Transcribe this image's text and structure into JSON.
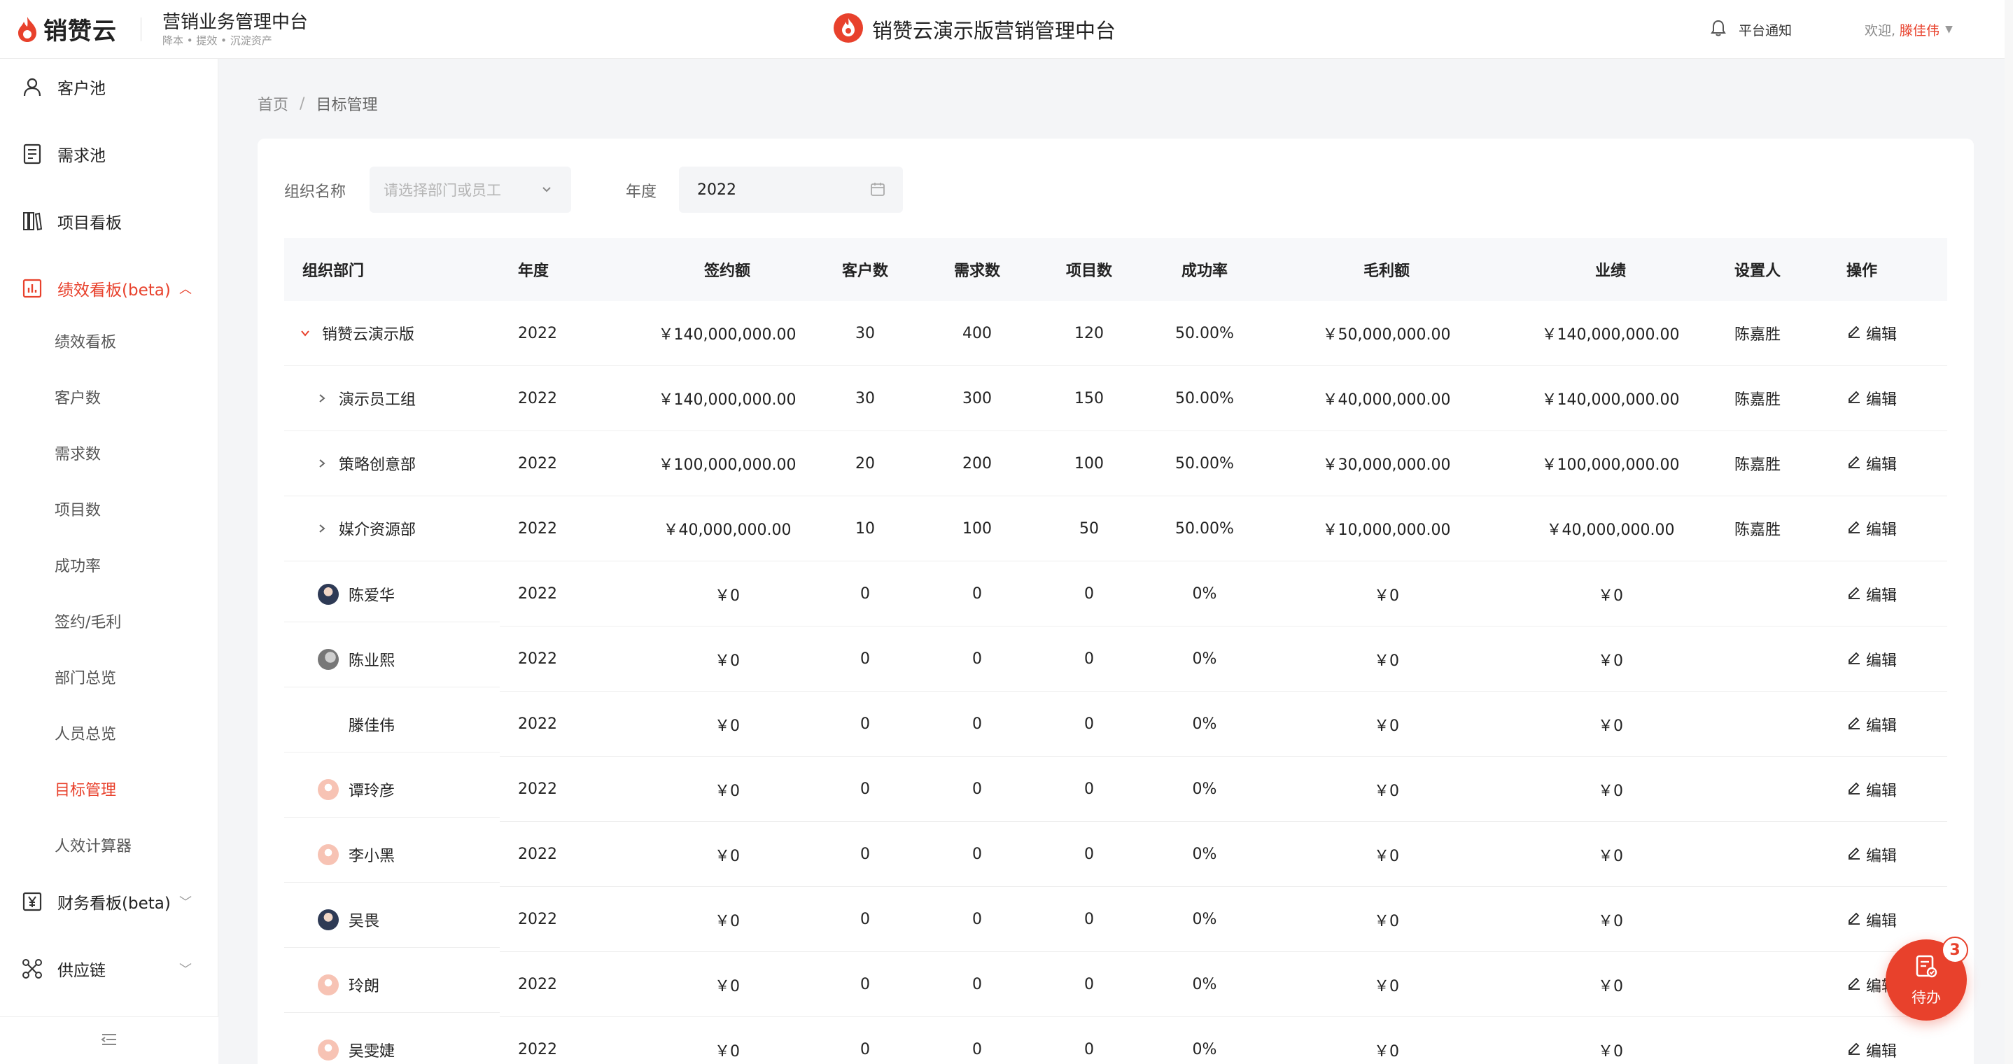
{
  "header": {
    "logo_text": "销赞云",
    "platform_title": "营销业务管理中台",
    "platform_sub": "降本 • 提效 • 沉淀资产",
    "center_title": "销赞云演示版营销管理中台",
    "notice_label": "平台通知",
    "welcome_label": "欢迎,",
    "username": "滕佳伟"
  },
  "sidebar": {
    "items": [
      {
        "label": "客户池",
        "icon": "user-icon"
      },
      {
        "label": "需求池",
        "icon": "document-icon"
      },
      {
        "label": "项目看板",
        "icon": "books-icon"
      },
      {
        "label": "绩效看板(beta)",
        "icon": "bar-chart-icon"
      }
    ],
    "sub_items": [
      "绩效看板",
      "客户数",
      "需求数",
      "项目数",
      "成功率",
      "签约/毛利",
      "部门总览",
      "人员总览",
      "目标管理",
      "人效计算器"
    ],
    "bottom_items": [
      {
        "label": "财务看板(beta)",
        "icon": "yen-icon"
      },
      {
        "label": "供应链",
        "icon": "network-icon"
      }
    ]
  },
  "breadcrumb": {
    "home": "首页",
    "separator": "/",
    "current": "目标管理"
  },
  "filters": {
    "org_label": "组织名称",
    "org_placeholder": "请选择部门或员工",
    "year_label": "年度",
    "year_value": "2022"
  },
  "table": {
    "headers": [
      "组织部门",
      "年度",
      "签约额",
      "客户数",
      "需求数",
      "项目数",
      "成功率",
      "毛利额",
      "业绩",
      "设置人",
      "操作"
    ],
    "edit_label": "编辑",
    "rows": [
      {
        "name": "销赞云演示版",
        "year": "2022",
        "sign": "￥140,000,000.00",
        "cust": "30",
        "need": "400",
        "proj": "120",
        "rate": "50.00%",
        "gross": "￥50,000,000.00",
        "perf": "￥140,000,000.00",
        "setter": "陈嘉胜"
      },
      {
        "name": "演示员工组",
        "year": "2022",
        "sign": "￥140,000,000.00",
        "cust": "30",
        "need": "300",
        "proj": "150",
        "rate": "50.00%",
        "gross": "￥40,000,000.00",
        "perf": "￥140,000,000.00",
        "setter": "陈嘉胜"
      },
      {
        "name": "策略创意部",
        "year": "2022",
        "sign": "￥100,000,000.00",
        "cust": "20",
        "need": "200",
        "proj": "100",
        "rate": "50.00%",
        "gross": "￥30,000,000.00",
        "perf": "￥100,000,000.00",
        "setter": "陈嘉胜"
      },
      {
        "name": "媒介资源部",
        "year": "2022",
        "sign": "￥40,000,000.00",
        "cust": "10",
        "need": "100",
        "proj": "50",
        "rate": "50.00%",
        "gross": "￥10,000,000.00",
        "perf": "￥40,000,000.00",
        "setter": "陈嘉胜"
      },
      {
        "name": "陈爱华",
        "year": "2022",
        "sign": "￥0",
        "cust": "0",
        "need": "0",
        "proj": "0",
        "rate": "0%",
        "gross": "￥0",
        "perf": "￥0",
        "setter": ""
      },
      {
        "name": "陈业熙",
        "year": "2022",
        "sign": "￥0",
        "cust": "0",
        "need": "0",
        "proj": "0",
        "rate": "0%",
        "gross": "￥0",
        "perf": "￥0",
        "setter": ""
      },
      {
        "name": "滕佳伟",
        "year": "2022",
        "sign": "￥0",
        "cust": "0",
        "need": "0",
        "proj": "0",
        "rate": "0%",
        "gross": "￥0",
        "perf": "￥0",
        "setter": ""
      },
      {
        "name": "谭玲彦",
        "year": "2022",
        "sign": "￥0",
        "cust": "0",
        "need": "0",
        "proj": "0",
        "rate": "0%",
        "gross": "￥0",
        "perf": "￥0",
        "setter": ""
      },
      {
        "name": "李小黑",
        "year": "2022",
        "sign": "￥0",
        "cust": "0",
        "need": "0",
        "proj": "0",
        "rate": "0%",
        "gross": "￥0",
        "perf": "￥0",
        "setter": ""
      },
      {
        "name": "吴畏",
        "year": "2022",
        "sign": "￥0",
        "cust": "0",
        "need": "0",
        "proj": "0",
        "rate": "0%",
        "gross": "￥0",
        "perf": "￥0",
        "setter": ""
      },
      {
        "name": "玲朗",
        "year": "2022",
        "sign": "￥0",
        "cust": "0",
        "need": "0",
        "proj": "0",
        "rate": "0%",
        "gross": "￥0",
        "perf": "￥0",
        "setter": ""
      },
      {
        "name": "吴雯婕",
        "year": "2022",
        "sign": "￥0",
        "cust": "0",
        "need": "0",
        "proj": "0",
        "rate": "0%",
        "gross": "￥0",
        "perf": "￥0",
        "setter": ""
      }
    ]
  },
  "todo": {
    "label": "待办",
    "count": "3"
  },
  "colors": {
    "accent": "#e8412c",
    "text": "#222222",
    "muted": "#888888"
  }
}
